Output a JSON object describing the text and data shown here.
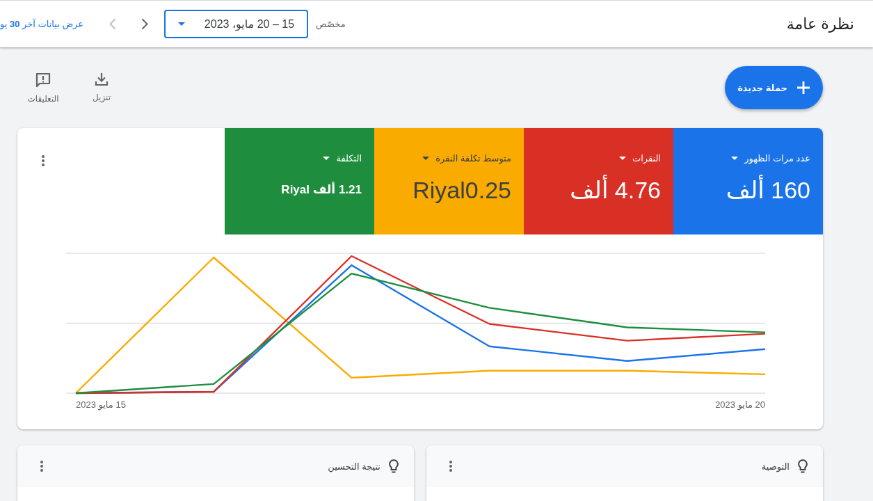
{
  "header": {
    "title": "نظرة عامة",
    "range_label": "مخصّص",
    "date_range": "15 – 20 مايو، 2023",
    "date_nav": [
      {
        "kind": "back",
        "disabled": false
      },
      {
        "kind": "forward",
        "disabled": true
      }
    ],
    "link": "عرض بيانات آخر **30** يو"
  },
  "toolbar": {
    "new_button": "حملة جديدة",
    "actions": [
      {
        "kind": "download",
        "label": "تنزيل"
      },
      {
        "kind": "feedback",
        "label": "التعليقات"
      }
    ]
  },
  "overview": {
    "metrics": [
      {
        "label": "عدد مرات الظهور",
        "value": "160 ألف",
        "kind": "headline",
        "selected": true,
        "color": "#1a73e8"
      },
      {
        "label": "النقرات",
        "value": "4.76 ألف",
        "kind": "headline",
        "selected": true,
        "color": "#d93025"
      },
      {
        "label": "متوسط تكلفة النقرة",
        "value": "Riyal0.25",
        "kind": "headline",
        "selected": true,
        "color": "#f9ab00"
      },
      {
        "label": "التكلفة",
        "value": "1.21 ألف Riyal",
        "kind": "compact",
        "selected": true,
        "color": "#1e8e3e"
      }
    ],
    "trend_chart": {
      "date_labels": [
        "20 مايو 2023",
        "15 مايو 2023"
      ]
    }
  },
  "cards": [
    {
      "title": "التوصية"
    },
    {
      "title": "نتيجة التحسين"
    }
  ]
}
